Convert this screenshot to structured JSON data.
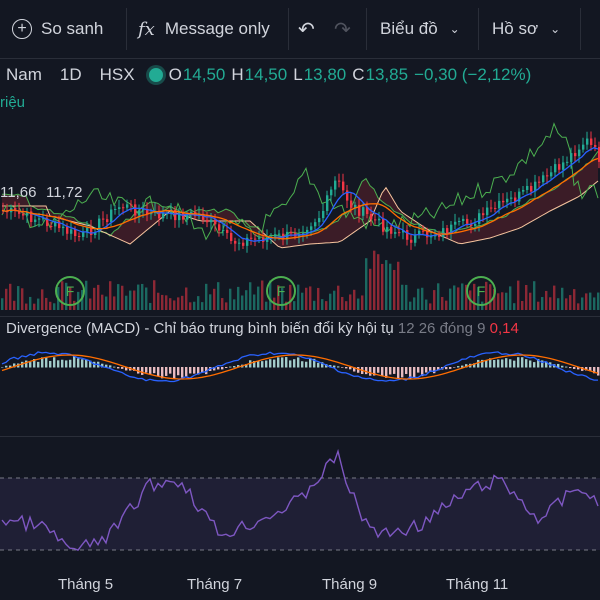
{
  "toolbar": {
    "compare_label": "So sanh",
    "message_label": "Message only",
    "chart_type_label": "Biểu đồ",
    "profile_label": "Hồ sơ",
    "fx_symbol": "fx"
  },
  "legend": {
    "name": "Nam",
    "interval": "1D",
    "exchange": "HSX",
    "open_label": "O",
    "open_value": "14,50",
    "high_label": "H",
    "high_value": "14,50",
    "low_label": "L",
    "low_value": "13,80",
    "close_label": "C",
    "close_value": "13,85",
    "change": "−0,30 (−2,12%)",
    "subtitle": "riệu"
  },
  "ma_labels": [
    "11,66",
    "11,72"
  ],
  "macd": {
    "title": "Divergence (MACD) - Chỉ báo trung bình biến đổi kỳ hội tụ",
    "params": "12 26 đóng 9",
    "value": "0,14"
  },
  "x_axis": [
    "Tháng 5",
    "Tháng 7",
    "Tháng 9",
    "Tháng 11"
  ],
  "event_marker": "F",
  "colors": {
    "up": "#22ab94",
    "down": "#f23645",
    "background": "#131722",
    "rsi": "#7e57c2",
    "macd_line": "#2962ff",
    "signal_line": "#ff6d00",
    "cloud_green": "#4caf50",
    "cloud_red": "#f23645"
  }
}
